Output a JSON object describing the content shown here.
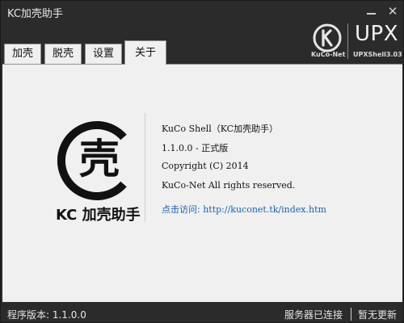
{
  "window": {
    "title": "KC加壳助手"
  },
  "brand": {
    "name": "KuCo-Net",
    "product": "UPX",
    "version_label": "UPXShell3.03"
  },
  "tabs": [
    {
      "label": "加壳",
      "active": false
    },
    {
      "label": "脱壳",
      "active": false
    },
    {
      "label": "设置",
      "active": false
    },
    {
      "label": "关于",
      "active": true
    }
  ],
  "about": {
    "logo_char": "壳",
    "app_name": "KC 加壳助手",
    "product_line": "KuCo Shell（KC加壳助手）",
    "version_line": "1.1.0.0 - 正式版",
    "copyright_line": "Copyright (C) 2014",
    "rights_line": "KuCo-Net All rights reserved.",
    "link_label": "点击访问:",
    "link_url": "http://kuconet.tk/index.htm"
  },
  "status": {
    "program_version": "程序版本: 1.1.0.0",
    "connection": "服务器已连接",
    "update": "暂无更新"
  },
  "colors": {
    "frame": "#2b2b2b",
    "panel": "#f0f0f0",
    "link": "#1a5fb4"
  }
}
